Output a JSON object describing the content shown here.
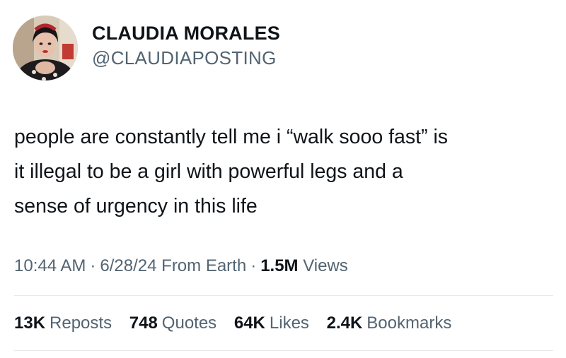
{
  "author": {
    "display_name": "CLAUDIA MORALES",
    "handle": "@CLAUDIAPOSTING"
  },
  "tweet": {
    "text": "people are constantly tell me i “walk sooo fast” is\nit illegal to be a girl with powerful legs and a\nsense of urgency in this life"
  },
  "meta": {
    "time": "10:44 AM",
    "date": "6/28/24",
    "source": "From Earth",
    "separator": "·",
    "views_count": "1.5M",
    "views_label": "Views"
  },
  "stats": {
    "reposts": {
      "count": "13K",
      "label": "Reposts"
    },
    "quotes": {
      "count": "748",
      "label": "Quotes"
    },
    "likes": {
      "count": "64K",
      "label": "Likes"
    },
    "bookmarks": {
      "count": "2.4K",
      "label": "Bookmarks"
    }
  },
  "colors": {
    "text": "#0f1419",
    "secondary": "#536471",
    "divider": "#e7e9ea"
  }
}
